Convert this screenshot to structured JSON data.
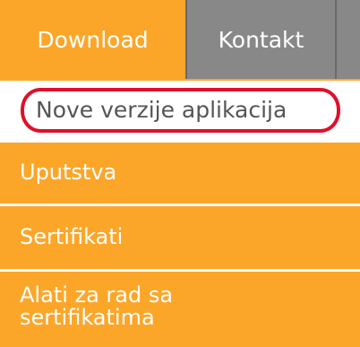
{
  "nav": {
    "tabs": [
      {
        "label": "Download"
      },
      {
        "label": "Kontakt"
      }
    ]
  },
  "submenu": {
    "items": [
      {
        "label": "Nove verzije aplikacija"
      },
      {
        "label": "Uputstva"
      },
      {
        "label": "Sertifikati"
      },
      {
        "label": "Alati za rad sa\nsertifikatima"
      }
    ]
  },
  "colors": {
    "accent": "#fca629",
    "tab_inactive": "#888888",
    "highlight": "#e0102a",
    "text_active": "#555555"
  }
}
